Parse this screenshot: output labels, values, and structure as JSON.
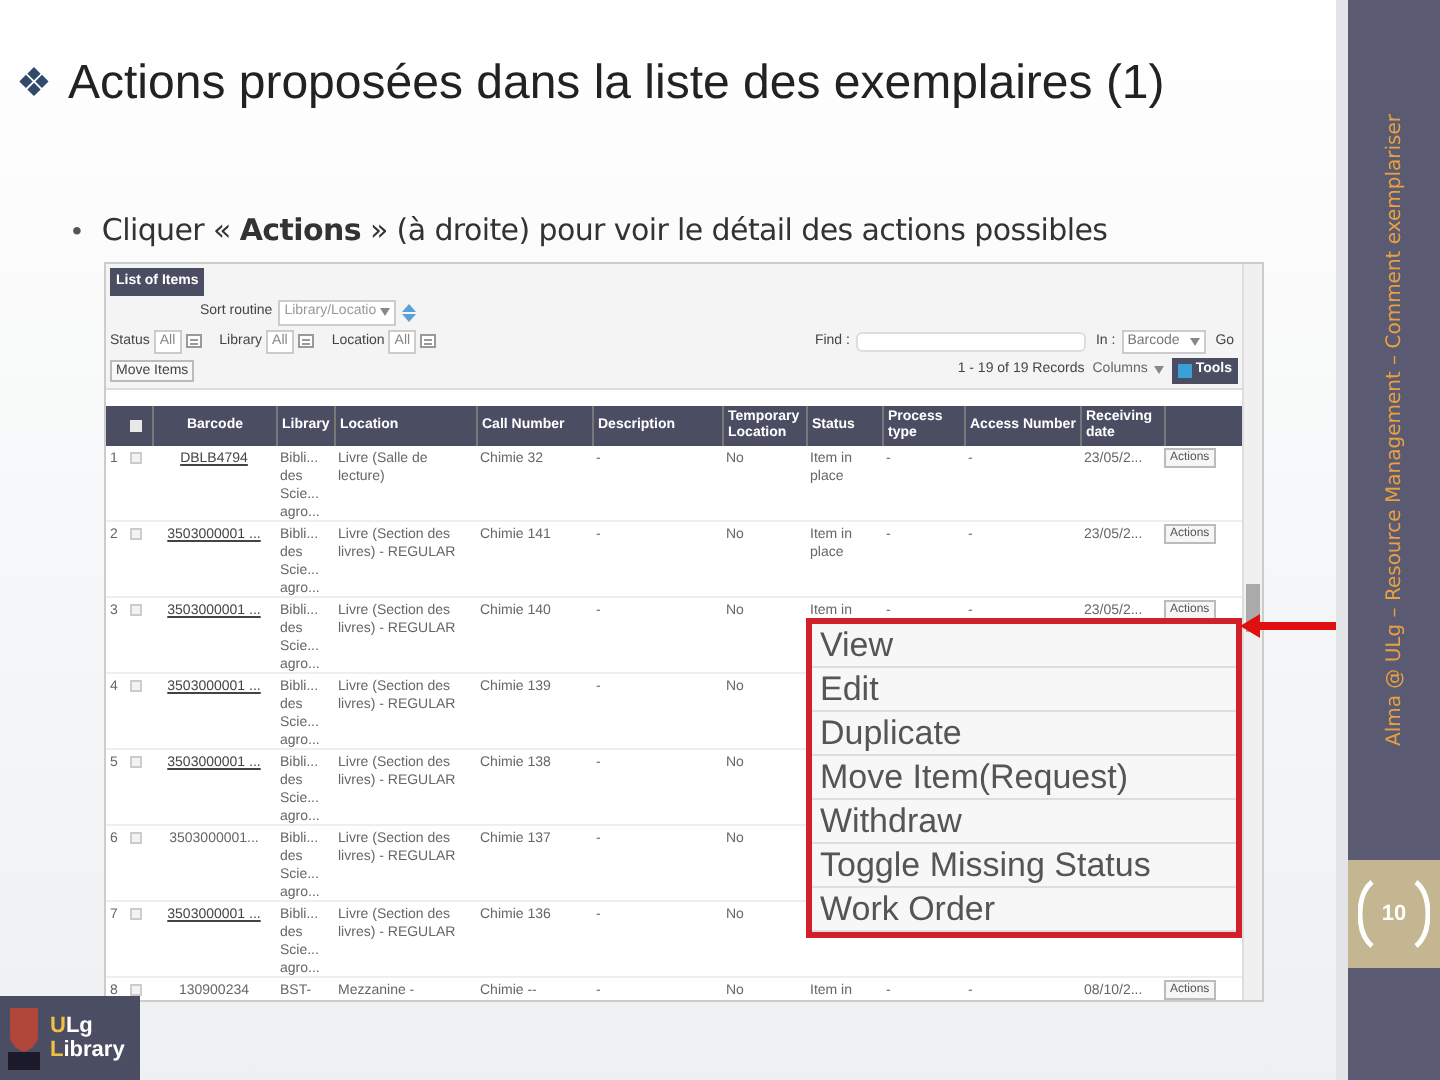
{
  "slide": {
    "title_icon": "❖",
    "title": "Actions proposées dans la liste des exemplaires (1)",
    "point_bullet": "•",
    "point": "Cliquer « **Actions** » (à droite) pour voir le détail des actions possibles"
  },
  "app": {
    "tab": "List of Items",
    "sort_label": "Sort routine",
    "sort_value": "Library/Locatio",
    "filters": [
      {
        "label": "Status",
        "value": "All"
      },
      {
        "label": "Library",
        "value": "All"
      },
      {
        "label": "Location",
        "value": "All"
      }
    ],
    "find_label": "Find :",
    "in_label": "In :",
    "in_value": "Barcode",
    "go": "Go",
    "move_button": "Move Items",
    "records": "1 - 19 of 19 Records",
    "columns": "Columns",
    "tools": "Tools",
    "table": {
      "all_checked": false,
      "columns": [
        "Barcode",
        "Library",
        "Location",
        "Call Number",
        "Description",
        "Temporary Location",
        "Status",
        "Process type",
        "Access Number",
        "Receiving date"
      ],
      "rows": [
        {
          "n": "1",
          "checked": false,
          "barcode": "DBLB4794",
          "link": true,
          "library": "Bibli... des Scie... agro...",
          "location": "Livre (Salle de lecture)",
          "call": "Chimie 32",
          "description": "-",
          "temp": "No",
          "status": "Item in place",
          "process": "-",
          "access": "-",
          "date": "23/05/2...",
          "action": "Actions"
        },
        {
          "n": "2",
          "checked": false,
          "barcode": "3503000001 ...",
          "link": true,
          "library": "Bibli... des Scie... agro...",
          "location": "Livre (Section des livres) - REGULAR",
          "call": "Chimie 141",
          "description": "-",
          "temp": "No",
          "status": "Item in place",
          "process": "-",
          "access": "-",
          "date": "23/05/2...",
          "action": "Actions"
        },
        {
          "n": "3",
          "checked": false,
          "barcode": "3503000001 ...",
          "link": true,
          "library": "Bibli... des Scie... agro...",
          "location": "Livre (Section des livres) - REGULAR",
          "call": "Chimie 140",
          "description": "-",
          "temp": "No",
          "status": "Item in",
          "process": "-",
          "access": "-",
          "date": "23/05/2...",
          "action": "Actions"
        },
        {
          "n": "4",
          "checked": false,
          "barcode": "3503000001 ...",
          "link": true,
          "library": "Bibli... des Scie... agro...",
          "location": "Livre (Section des livres) - REGULAR",
          "call": "Chimie 139",
          "description": "-",
          "temp": "No"
        },
        {
          "n": "5",
          "checked": false,
          "barcode": "3503000001 ...",
          "link": true,
          "library": "Bibli... des Scie... agro...",
          "location": "Livre (Section des livres) - REGULAR",
          "call": "Chimie 138",
          "description": "-",
          "temp": "No"
        },
        {
          "n": "6",
          "checked": false,
          "barcode": "3503000001...",
          "link": false,
          "library": "Bibli... des Scie... agro...",
          "location": "Livre (Section des livres) - REGULAR",
          "call": "Chimie 137",
          "description": "-",
          "temp": "No"
        },
        {
          "n": "7",
          "checked": false,
          "barcode": "3503000001 ...",
          "link": true,
          "library": "Bibli... des Scie... agro...",
          "location": "Livre (Section des livres) - REGULAR",
          "call": "Chimie 136",
          "description": "-",
          "temp": "No"
        },
        {
          "n": "8",
          "checked": false,
          "barcode": "130900234",
          "link": false,
          "library": "BST-",
          "location": "Mezzanine -",
          "call": "Chimie --",
          "description": "-",
          "temp": "No",
          "status": "Item in",
          "process": "-",
          "access": "-",
          "date": "08/10/2...",
          "action": "Actions"
        }
      ]
    },
    "menu": {
      "items": [
        "View",
        "Edit",
        "Duplicate",
        "Move Item(Request)",
        "Withdraw",
        "Toggle Missing Status",
        "Work Order"
      ]
    }
  },
  "sidebar": {
    "footer": "Alma @ ULg – Resource Management – Comment exemplariser",
    "page": "10"
  },
  "logo": {
    "line1": "ULg",
    "line2": "Library"
  }
}
